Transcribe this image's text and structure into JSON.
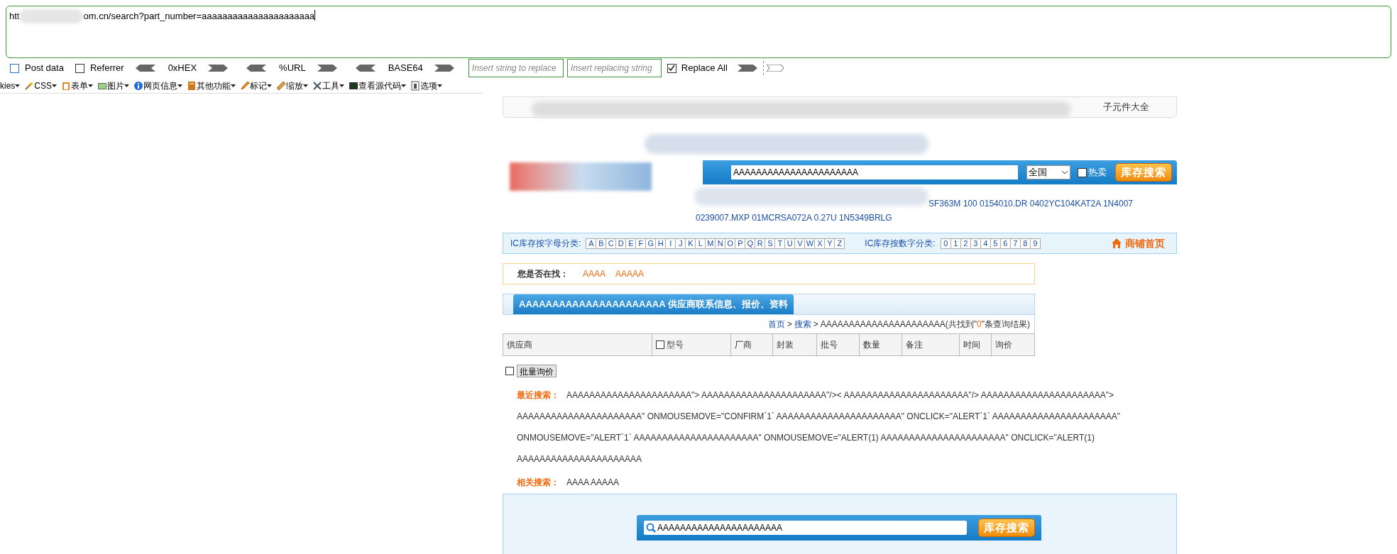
{
  "address_bar": {
    "url_start": "htt",
    "url_end": "om.cn/search?part_number=aaaaaaaaaaaaaaaaaaaaaa"
  },
  "hackbar": {
    "options": [
      {
        "label": "Post data",
        "checked": false
      },
      {
        "label": "Referrer",
        "checked": false
      }
    ],
    "encoders": [
      "0xHEX",
      "%URL",
      "BASE64"
    ],
    "replace_placeholder": "Insert string to replace",
    "replacing_placeholder": "Insert replacing string",
    "replace_all": {
      "label": "Replace All",
      "checked": true
    }
  },
  "menu": [
    "kies",
    "CSS",
    "表单",
    "图片",
    "网页信息",
    "其他功能",
    "标记",
    "缩放",
    "工具",
    "查看源代码",
    "选项"
  ],
  "top_links": [
    "子元件大全"
  ],
  "search": {
    "value": "AAAAAAAAAAAAAAAAAAAAAA",
    "region": "全国",
    "hot_sale": {
      "label": "热卖",
      "checked": false
    },
    "button": "库存搜索"
  },
  "hot_keywords": [
    "SF363M 100 0154010.DR 0402YC104KAT2A 1N4007",
    "0239007.MXP 01MCRSA072A 0.27U 1N5349BRLG"
  ],
  "categories": {
    "letter_label": "IC库存按字母分类:",
    "letters": [
      "A",
      "B",
      "C",
      "D",
      "E",
      "F",
      "G",
      "H",
      "I",
      "J",
      "K",
      "L",
      "M",
      "N",
      "O",
      "P",
      "Q",
      "R",
      "S",
      "T",
      "U",
      "V",
      "W",
      "X",
      "Y",
      "Z"
    ],
    "digit_label": "IC库存按数字分类:",
    "digits": [
      "0",
      "1",
      "2",
      "3",
      "4",
      "5",
      "6",
      "7",
      "8",
      "9"
    ],
    "shop_home": "商铺首页"
  },
  "suggest": {
    "label": "您是否在找：",
    "items": [
      "AAAA",
      "AAAAA"
    ]
  },
  "title": "AAAAAAAAAAAAAAAAAAAAAA 供应商联系信息、报价、资料",
  "breadcrumb": {
    "home": "首页",
    "separators": [
      ">",
      ">"
    ],
    "search": "搜索",
    "before": "AAAAAAAAAAAAAAAAAAAAAA(共找到\"",
    "count": "0",
    "after": "\"条查询结果)"
  },
  "table": {
    "columns": [
      {
        "label": "供应商",
        "kind": "text"
      },
      {
        "label": "型号",
        "kind": "checkbox",
        "checked": false
      },
      {
        "label": "厂商",
        "kind": "text"
      },
      {
        "label": "封装",
        "kind": "text"
      },
      {
        "label": "批号",
        "kind": "text"
      },
      {
        "label": "数量",
        "kind": "text"
      },
      {
        "label": "备注",
        "kind": "text"
      },
      {
        "label": "时间",
        "kind": "text"
      },
      {
        "label": "询价",
        "kind": "text"
      }
    ]
  },
  "batch": {
    "checked": false,
    "button": "批量询价"
  },
  "recent": {
    "label": "最近搜索：",
    "lines": [
      "AAAAAAAAAAAAAAAAAAAAAA\"> AAAAAAAAAAAAAAAAAAAAAA\"/>< AAAAAAAAAAAAAAAAAAAAAA\"/> AAAAAAAAAAAAAAAAAAAAAA\">",
      "AAAAAAAAAAAAAAAAAAAAAA\" ONMOUSEMOVE=\"CONFIRM`1` AAAAAAAAAAAAAAAAAAAAAA\" ONCLICK=\"ALERT`1` AAAAAAAAAAAAAAAAAAAAAA\"",
      "ONMOUSEMOVE=\"ALERT`1` AAAAAAAAAAAAAAAAAAAAAA\" ONMOUSEMOVE=\"ALERT(1) AAAAAAAAAAAAAAAAAAAAAA\" ONCLICK=\"ALERT(1)",
      "AAAAAAAAAAAAAAAAAAAAAA"
    ]
  },
  "related": {
    "label": "相关搜索：",
    "text": "AAAA AAAAA"
  },
  "bottom_search": {
    "value": "AAAAAAAAAAAAAAAAAAAAAA",
    "button": "库存搜索"
  }
}
